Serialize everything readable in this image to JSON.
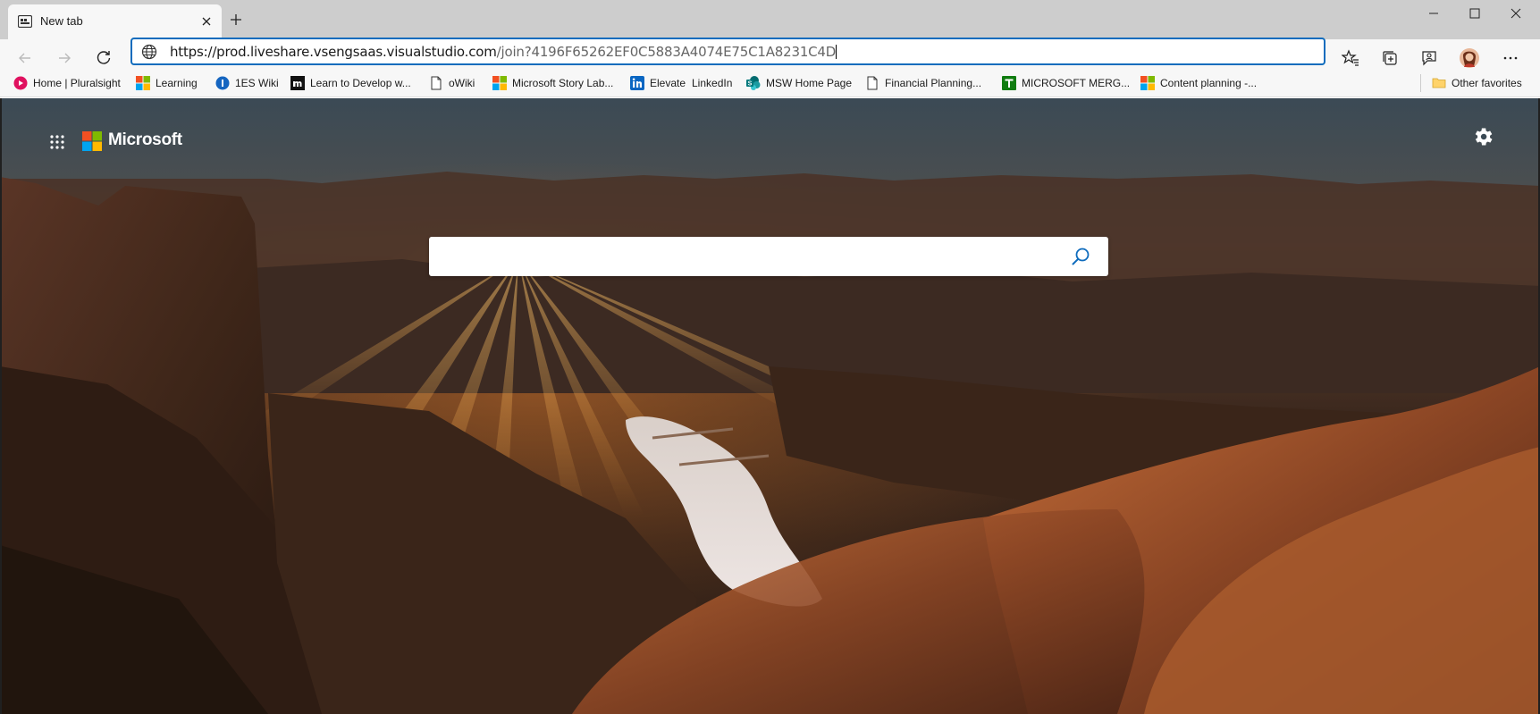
{
  "tab": {
    "title": "New tab"
  },
  "window": {
    "minimize": "minimize-icon",
    "maximize": "maximize-icon",
    "close": "close-icon"
  },
  "address_bar": {
    "url_host": "https://prod.liveshare.vsengsaas.visualstudio.com",
    "url_path": "/join?4196F65262EF0C5883A4074E75C1A8231C4D"
  },
  "favorites": [
    {
      "label": "Home | Pluralsight",
      "icon": "pluralsight-icon"
    },
    {
      "label": "Learning",
      "icon": "microsoft-icon"
    },
    {
      "label": "1ES Wiki",
      "icon": "1es-icon"
    },
    {
      "label": "Learn to Develop w...",
      "icon": "m-icon"
    },
    {
      "label": "oWiki",
      "icon": "page-icon"
    },
    {
      "label": "Microsoft Story Lab...",
      "icon": "microsoft-icon"
    },
    {
      "label": "Elevate",
      "icon": "linkedin-icon"
    },
    {
      "label": "LinkedIn",
      "icon": "none"
    },
    {
      "label": "MSW Home Page",
      "icon": "sharepoint-icon"
    },
    {
      "label": "Financial Planning...",
      "icon": "page-icon"
    },
    {
      "label": "MICROSOFT MERG...",
      "icon": "t-icon"
    },
    {
      "label": "Content planning -...",
      "icon": "microsoft-icon"
    }
  ],
  "other_favorites": "Other favorites",
  "page": {
    "brand": "Microsoft",
    "search_placeholder": ""
  },
  "colors": {
    "accent": "#0f6cbd",
    "ms_red": "#f25022",
    "ms_green": "#7fba00",
    "ms_blue": "#00a4ef",
    "ms_yellow": "#ffb900"
  }
}
